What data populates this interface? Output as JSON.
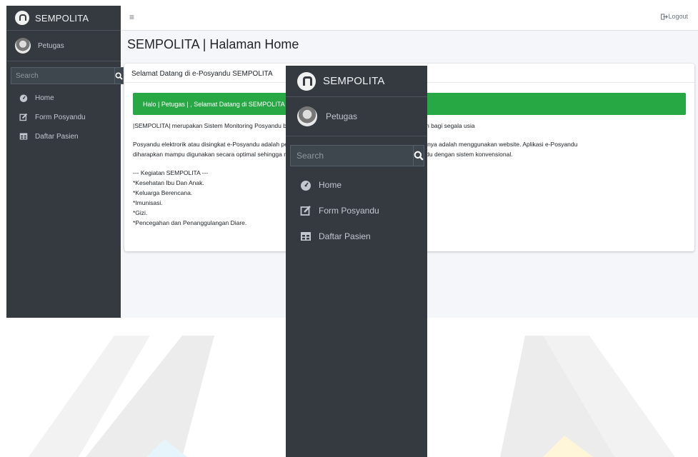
{
  "brand": {
    "name": "SEMPOLITA"
  },
  "user": {
    "name": "Petugas"
  },
  "search": {
    "placeholder": "Search"
  },
  "nav": {
    "items": [
      {
        "label": "Home",
        "icon": "dashboard-icon"
      },
      {
        "label": "Form Posyandu",
        "icon": "edit-icon"
      },
      {
        "label": "Daftar Pasien",
        "icon": "table-icon"
      }
    ]
  },
  "topbar": {
    "menu_icon": "≡",
    "logout_label": "Logout"
  },
  "page": {
    "title": "SEMPOLITA | Halaman Home"
  },
  "card": {
    "header": "Selamat Datang di e-Posyandu SEMPOLITA",
    "alert": "Halo | Petugas | , Selamat Datang di SEMPOLITA",
    "para1": "|SEMPOLITA| merupakan Sistem Monitoring Posyandu berbasis elektronik yang mudah digunakan dan ramah bagi segala usia",
    "para2_line1": "Posyandu elektrorik atau disingkat e-Posyandu adalah pelayanan pada kegiatan posyandu. Basis penggunaanya adalah menggunakan website. Aplikasi e-Posyandu",
    "para2_line2": "diharapkan mampu digunakan secara optimal sehingga mengatasi permasalahan yang dihadapi oleh posyandu dengan sistem konvensional.",
    "kegiatan_title": "--- Kegiatan SEMPOLITA ---",
    "kegiatan": [
      "*Kesehatan Ibu Dan Anak.",
      "*Keluarga Berencana.",
      "*Imunisasi.",
      "*Gizi.",
      "*Pencegahan dan Penanggulangan Diare."
    ]
  },
  "colors": {
    "sidebar": "#343a40",
    "alert_green": "#28a745",
    "content_bg": "#f4f6f9"
  }
}
